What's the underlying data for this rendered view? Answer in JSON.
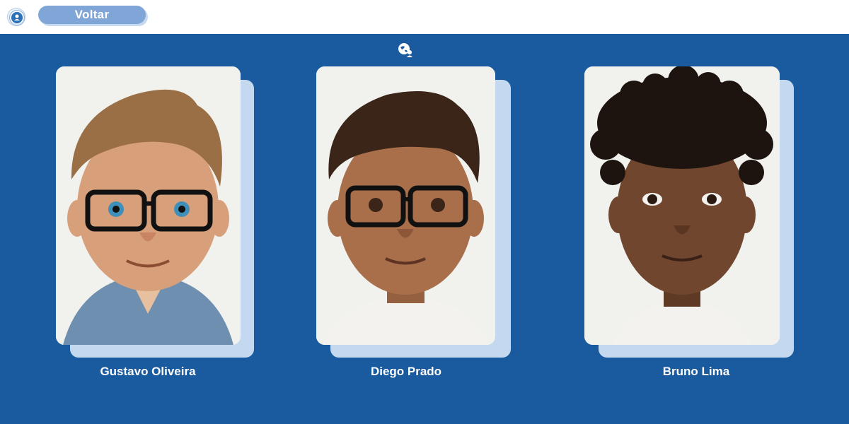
{
  "header": {
    "back_label": "Voltar",
    "logo_icon": "globe-badge-icon"
  },
  "main": {
    "center_icon": "world-people-icon",
    "people": [
      {
        "name": "Gustavo Oliveira",
        "hair": "#9a6f45",
        "skin": "#d8a07a",
        "eyes": "#3f8fb8",
        "shirt": "#6f8fb0"
      },
      {
        "name": "Diego Prado",
        "hair": "#3b2418",
        "skin": "#a96f4b",
        "eyes": "#3b2418",
        "shirt": "#f4f2ee"
      },
      {
        "name": "Bruno Lima",
        "hair": "#1e140f",
        "skin": "#70462e",
        "eyes": "#2a1a12",
        "shirt": "#f4f2ee"
      }
    ]
  },
  "colors": {
    "background": "#1a5a9e",
    "card_shadow": "#c4d9f0",
    "button": "#7fa6d6"
  }
}
